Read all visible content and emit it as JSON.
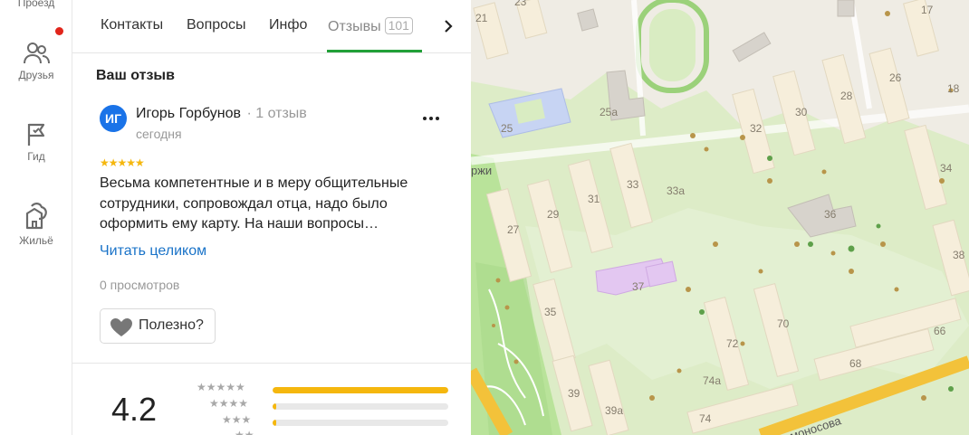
{
  "rail": {
    "items": [
      {
        "label": "Проезд",
        "icon": "route-icon"
      },
      {
        "label": "Друзья",
        "icon": "friends-icon",
        "notification": true
      },
      {
        "label": "Гид",
        "icon": "flag-icon"
      },
      {
        "label": "Жильё",
        "icon": "housing-icon"
      }
    ]
  },
  "tabs": {
    "items": [
      {
        "label": "Контакты"
      },
      {
        "label": "Вопросы"
      },
      {
        "label": "Инфо"
      },
      {
        "label": "Отзывы",
        "count": "101",
        "active": true
      }
    ]
  },
  "review": {
    "section_title": "Ваш отзыв",
    "avatar_initials": "ИГ",
    "author": "Игорь Горбунов",
    "author_meta": "· 1 отзыв",
    "date": "сегодня",
    "stars": "★★★★★",
    "rating": 5,
    "text": "Весьма компетентные и в меру общительные сотрудники, сопровождал отца, надо было оформить ему карту. На наши вопросы…",
    "read_more": "Читать целиком",
    "views": "0 просмотров",
    "useful_label": "Полезно?"
  },
  "summary": {
    "rating": "4.2",
    "distribution": [
      {
        "stars": "★★★★★",
        "fraction": 1.0
      },
      {
        "stars": "★★★★",
        "fraction": 0.02
      },
      {
        "stars": "★★★",
        "fraction": 0.02
      },
      {
        "stars": "★★",
        "fraction": 0.02
      }
    ]
  },
  "map": {
    "colors": {
      "ground": "#efece4",
      "green": "#d9ecc2",
      "park": "#b9e39a",
      "building": "#f6eedb",
      "road": "#f3c23a",
      "pink": "#e3c7f1",
      "blue": "#c7d4f3"
    },
    "house_numbers": [
      "21",
      "23",
      "17",
      "25",
      "25а",
      "32",
      "30",
      "28",
      "26",
      "18",
      "34",
      "31",
      "33",
      "33а",
      "29",
      "27",
      "36",
      "38",
      "37",
      "35",
      "70",
      "66",
      "72",
      "68",
      "74а",
      "39",
      "39а",
      "74"
    ],
    "street_fragments": [
      "ржи",
      "моносова"
    ]
  }
}
